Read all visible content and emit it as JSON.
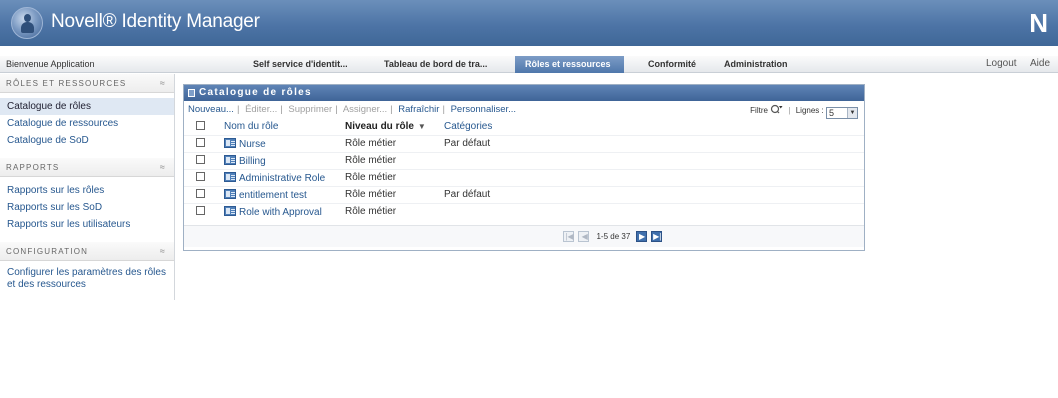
{
  "header": {
    "app_title": "Novell® Identity Manager",
    "brand_letter": "N"
  },
  "navbar": {
    "welcome": "Bienvenue Application",
    "tabs": [
      {
        "label": "Self service d'identit..."
      },
      {
        "label": "Tableau de bord de tra..."
      },
      {
        "label": "Rôles et ressources",
        "active": true
      },
      {
        "label": "Conformité"
      },
      {
        "label": "Administration"
      }
    ],
    "logout": "Logout",
    "help": "Aide"
  },
  "sidebar": {
    "sections": [
      {
        "title": "RÔLES ET RESSOURCES",
        "items": [
          "Catalogue de rôles",
          "Catalogue de ressources",
          "Catalogue de SoD"
        ]
      },
      {
        "title": "RAPPORTS",
        "items": [
          "Rapports sur les rôles",
          "Rapports sur les SoD",
          "Rapports sur les utilisateurs"
        ]
      },
      {
        "title": "CONFIGURATION",
        "items": [
          "Configurer les paramètres des rôles et des ressources"
        ]
      }
    ],
    "toggle_glyph": "≈"
  },
  "panel": {
    "title": "Catalogue de rôles",
    "toolbar": {
      "new": "Nouveau...",
      "edit": "Éditer...",
      "delete": "Supprimer",
      "assign": "Assigner...",
      "refresh": "Rafraîchir",
      "customize": "Personnaliser...",
      "filter_label": "Filtre",
      "rows_label": "Lignes :",
      "rows_value": "5"
    },
    "columns": [
      "Nom du rôle",
      "Niveau du rôle",
      "Catégories"
    ],
    "sort_glyph": "▼",
    "rows": [
      {
        "name": "Nurse",
        "level": "Rôle métier",
        "category": "Par défaut"
      },
      {
        "name": "Billing",
        "level": "Rôle métier",
        "category": ""
      },
      {
        "name": "Administrative Role",
        "level": "Rôle métier",
        "category": ""
      },
      {
        "name": "entitlement test",
        "level": "Rôle métier",
        "category": "Par défaut"
      },
      {
        "name": "Role with Approval",
        "level": "Rôle métier",
        "category": ""
      }
    ],
    "pager": {
      "text": "1-5 de 37"
    }
  },
  "colors": {
    "header_blue": "#4d74a6",
    "link_blue": "#27588f",
    "active_tab": "#4f77ab",
    "selected_item": "#dfe8f3"
  }
}
